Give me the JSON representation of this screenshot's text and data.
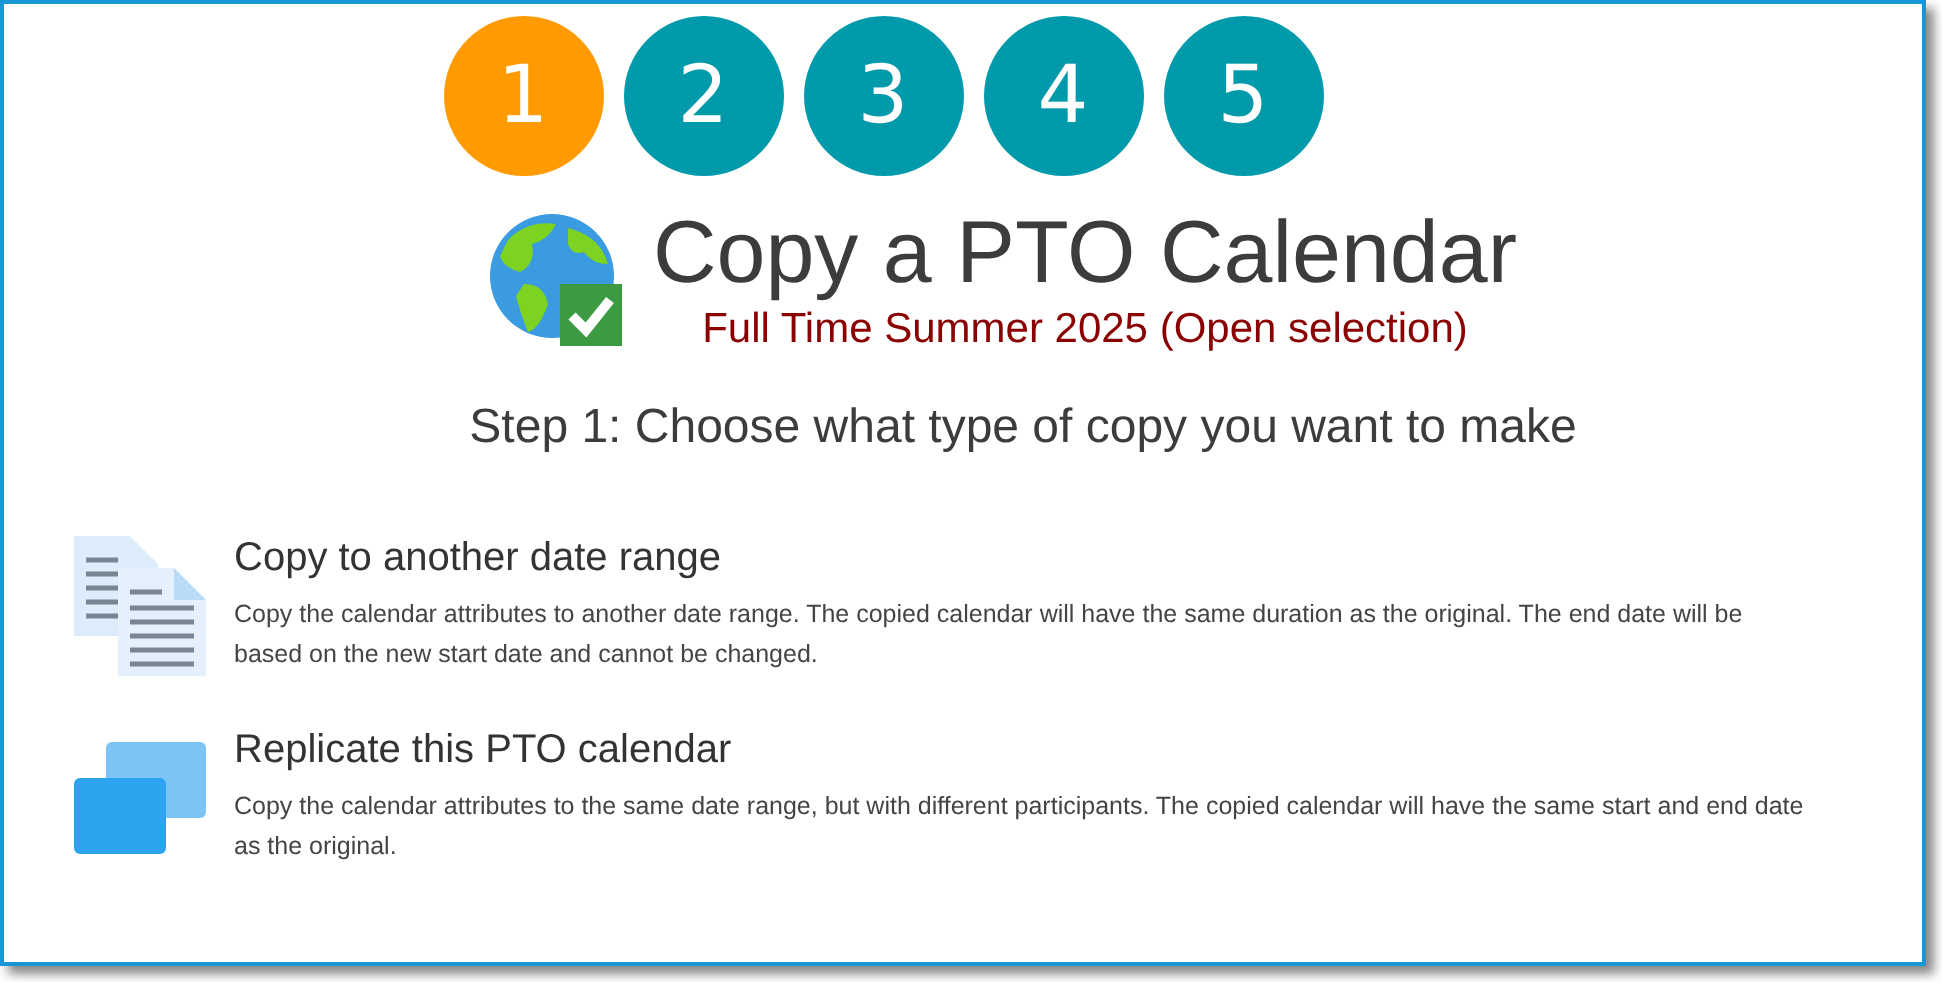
{
  "steps": [
    {
      "label": "1",
      "selected": true
    },
    {
      "label": "2",
      "selected": false
    },
    {
      "label": "3",
      "selected": false
    },
    {
      "label": "4",
      "selected": false
    },
    {
      "label": "5",
      "selected": false
    }
  ],
  "title": "Copy a PTO Calendar",
  "subtitle": "Full Time Summer 2025 (Open selection)",
  "step_heading": "Step 1: Choose what type of copy you want to make",
  "options": [
    {
      "kind": "documents",
      "title": "Copy to another date range",
      "description": "Copy the calendar attributes to another date range. The copied calendar will have the same duration as the original. The end date will be based on the new start date and cannot be changed."
    },
    {
      "kind": "squares",
      "title": "Replicate this PTO calendar",
      "description": "Copy the calendar attributes to the same date range, but with different participants. The copied calendar will have the same start and end date as the original."
    }
  ]
}
